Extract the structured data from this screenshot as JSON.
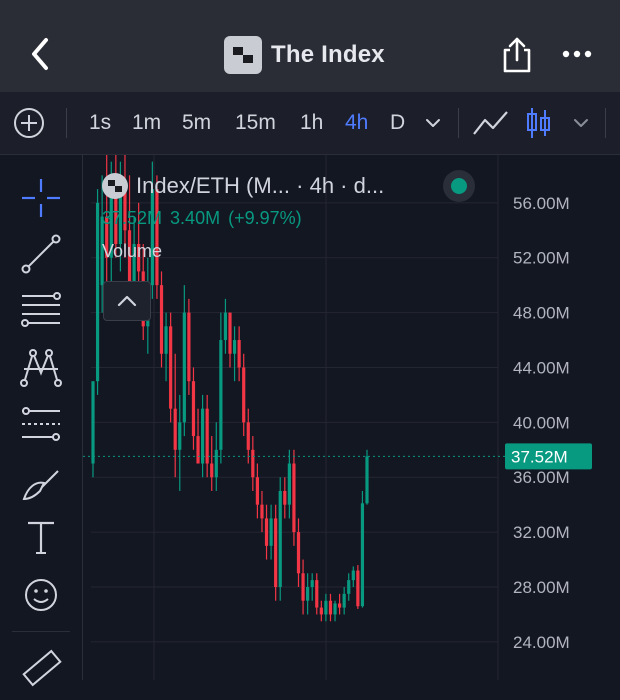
{
  "header": {
    "title": "The Index"
  },
  "toolbar": {
    "intervals": [
      "1s",
      "1m",
      "5m",
      "15m",
      "1h",
      "4h",
      "D"
    ],
    "active_interval": "4h"
  },
  "legend": {
    "title": "Index/ETH (M... · 4h · d...",
    "value": "37.52M",
    "change": "3.40M",
    "change_pct": "(+9.97%)",
    "volume_label": "Volume"
  },
  "colors": {
    "up": "#089981",
    "down": "#f23645",
    "accent": "#4f7cff",
    "background": "#131722"
  },
  "icons": {
    "header": [
      "back-arrow-icon",
      "index-logo-icon",
      "share-icon",
      "more-dots-icon"
    ],
    "toolbar": [
      "add-indicator-icon",
      "chevron-down-icon",
      "line-chart-icon",
      "candlestick-icon"
    ],
    "sidebar": [
      "crosshair-icon",
      "trend-line-icon",
      "fib-levels-icon",
      "pattern-icon",
      "prediction-icon",
      "brush-icon",
      "text-icon",
      "emoji-icon",
      "ruler-icon"
    ]
  },
  "chart_data": {
    "type": "candlestick",
    "series_label": "Index/ETH",
    "interval": "4h",
    "y_axis_ticks": [
      "56.00M",
      "52.00M",
      "48.00M",
      "44.00M",
      "40.00M",
      "36.00M",
      "32.00M",
      "28.00M",
      "24.00M"
    ],
    "ylim": [
      23.5,
      60.5
    ],
    "last_price": 37.52,
    "last_price_label": "37.52M",
    "grid": true,
    "candles": [
      {
        "o": 37,
        "h": 42,
        "l": 36,
        "c": 43
      },
      {
        "o": 43,
        "h": 57,
        "l": 42,
        "c": 56
      },
      {
        "o": 50,
        "h": 58,
        "l": 48,
        "c": 55
      },
      {
        "o": 55,
        "h": 60,
        "l": 49,
        "c": 52
      },
      {
        "o": 52,
        "h": 59,
        "l": 50,
        "c": 58
      },
      {
        "o": 58,
        "h": 60,
        "l": 52,
        "c": 53
      },
      {
        "o": 53,
        "h": 59,
        "l": 51,
        "c": 57
      },
      {
        "o": 57,
        "h": 60,
        "l": 52,
        "c": 54
      },
      {
        "o": 54,
        "h": 58,
        "l": 48,
        "c": 50
      },
      {
        "o": 50,
        "h": 55,
        "l": 48,
        "c": 53
      },
      {
        "o": 53,
        "h": 56,
        "l": 50,
        "c": 51
      },
      {
        "o": 51,
        "h": 53,
        "l": 46,
        "c": 47
      },
      {
        "o": 47,
        "h": 52,
        "l": 45,
        "c": 50
      },
      {
        "o": 50,
        "h": 59,
        "l": 49,
        "c": 57
      },
      {
        "o": 57,
        "h": 58,
        "l": 49,
        "c": 50
      },
      {
        "o": 50,
        "h": 51,
        "l": 44,
        "c": 45
      },
      {
        "o": 45,
        "h": 48,
        "l": 43,
        "c": 47
      },
      {
        "o": 47,
        "h": 48,
        "l": 40,
        "c": 41
      },
      {
        "o": 41,
        "h": 45,
        "l": 36,
        "c": 38
      },
      {
        "o": 38,
        "h": 42,
        "l": 35,
        "c": 40
      },
      {
        "o": 40,
        "h": 50,
        "l": 39,
        "c": 48
      },
      {
        "o": 48,
        "h": 49,
        "l": 42,
        "c": 43
      },
      {
        "o": 43,
        "h": 44,
        "l": 38,
        "c": 39
      },
      {
        "o": 39,
        "h": 41,
        "l": 37,
        "c": 37
      },
      {
        "o": 37,
        "h": 42,
        "l": 36,
        "c": 41
      },
      {
        "o": 41,
        "h": 42,
        "l": 36,
        "c": 37
      },
      {
        "o": 37,
        "h": 39,
        "l": 35,
        "c": 36
      },
      {
        "o": 36,
        "h": 40,
        "l": 35,
        "c": 38
      },
      {
        "o": 38,
        "h": 48,
        "l": 37,
        "c": 46
      },
      {
        "o": 46,
        "h": 49,
        "l": 45,
        "c": 48
      },
      {
        "o": 48,
        "h": 48,
        "l": 44,
        "c": 45
      },
      {
        "o": 45,
        "h": 47,
        "l": 43,
        "c": 46
      },
      {
        "o": 46,
        "h": 47,
        "l": 43,
        "c": 44
      },
      {
        "o": 44,
        "h": 45,
        "l": 39,
        "c": 40
      },
      {
        "o": 40,
        "h": 41,
        "l": 37,
        "c": 38
      },
      {
        "o": 38,
        "h": 39,
        "l": 35,
        "c": 36
      },
      {
        "o": 36,
        "h": 37,
        "l": 33,
        "c": 34
      },
      {
        "o": 34,
        "h": 35,
        "l": 32,
        "c": 33
      },
      {
        "o": 33,
        "h": 34,
        "l": 30,
        "c": 31
      },
      {
        "o": 31,
        "h": 34,
        "l": 30,
        "c": 33
      },
      {
        "o": 33,
        "h": 34,
        "l": 27,
        "c": 28
      },
      {
        "o": 28,
        "h": 36,
        "l": 27,
        "c": 35
      },
      {
        "o": 35,
        "h": 36,
        "l": 33,
        "c": 34
      },
      {
        "o": 34,
        "h": 38,
        "l": 33,
        "c": 37
      },
      {
        "o": 37,
        "h": 38,
        "l": 31,
        "c": 32
      },
      {
        "o": 32,
        "h": 33,
        "l": 28,
        "c": 29
      },
      {
        "o": 29,
        "h": 30,
        "l": 26,
        "c": 27
      },
      {
        "o": 27,
        "h": 29,
        "l": 26,
        "c": 28
      },
      {
        "o": 28,
        "h": 29,
        "l": 27,
        "c": 28.5
      },
      {
        "o": 28.5,
        "h": 29,
        "l": 26,
        "c": 26.5
      },
      {
        "o": 26.5,
        "h": 27,
        "l": 25.5,
        "c": 26
      },
      {
        "o": 26,
        "h": 27.5,
        "l": 25.5,
        "c": 27
      },
      {
        "o": 27,
        "h": 27.5,
        "l": 25.5,
        "c": 26
      },
      {
        "o": 26,
        "h": 27,
        "l": 25.5,
        "c": 26.8
      },
      {
        "o": 26.8,
        "h": 27.5,
        "l": 26,
        "c": 26.5
      },
      {
        "o": 26.5,
        "h": 28,
        "l": 26,
        "c": 27.5
      },
      {
        "o": 27.5,
        "h": 29,
        "l": 27,
        "c": 28.5
      },
      {
        "o": 28.5,
        "h": 29.5,
        "l": 28,
        "c": 29.2
      },
      {
        "o": 29.2,
        "h": 29.6,
        "l": 26.4,
        "c": 26.6
      },
      {
        "o": 26.6,
        "h": 35,
        "l": 26.5,
        "c": 34.1
      },
      {
        "o": 34.1,
        "h": 38,
        "l": 34,
        "c": 37.52
      }
    ]
  }
}
